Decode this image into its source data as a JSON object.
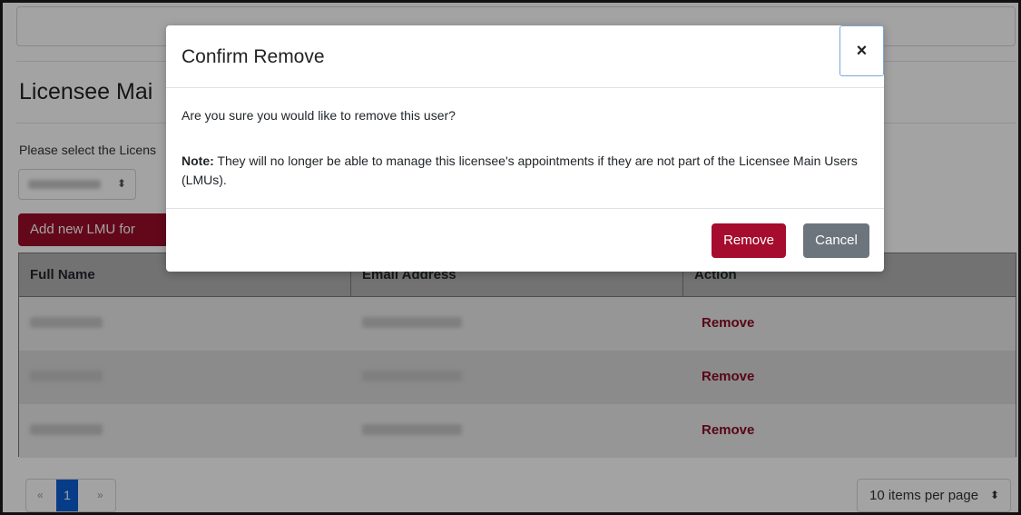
{
  "background": {
    "title": "Licensee Mai",
    "select_prompt": "Please select the Licens",
    "dropdown_caret": "⬍",
    "add_button_label": "Add new LMU for",
    "table": {
      "headers": [
        "Full Name",
        "Email Address",
        "Action"
      ],
      "rows": [
        {
          "action": "Remove"
        },
        {
          "action": "Remove"
        },
        {
          "action": "Remove"
        }
      ]
    },
    "pagination": {
      "prev": "«",
      "current_page": "1",
      "next": "»"
    },
    "per_page": {
      "label": "10 items per page",
      "caret": "⬍"
    }
  },
  "modal": {
    "title": "Confirm Remove",
    "close_symbol": "×",
    "question": "Are you sure you would like to remove this user?",
    "note_label": "Note:",
    "note_text": " They will no longer be able to manage this licensee's appointments if they are not part of the Licensee Main Users (LMUs).",
    "remove_label": "Remove",
    "cancel_label": "Cancel"
  },
  "colors": {
    "brand_red": "#9b0d2a",
    "cancel_gray": "#6c757d",
    "pagination_active": "#0b5ed7"
  }
}
